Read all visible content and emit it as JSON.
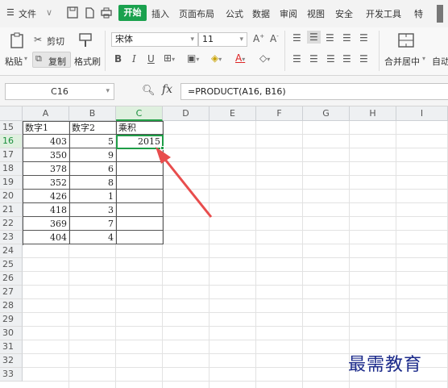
{
  "menu": {
    "items": [
      "文件",
      "开始",
      "插入",
      "页面布局",
      "公式",
      "数据",
      "审阅",
      "视图",
      "安全",
      "开发工具",
      "特"
    ],
    "active_index": 1
  },
  "ribbon": {
    "paste_label": "粘贴",
    "cut_label": "剪切",
    "copy_label": "复制",
    "format_painter_label": "格式刷",
    "font_name": "宋体",
    "font_size": "11",
    "merge_label": "合并居中",
    "autowrap_label": "自动"
  },
  "formula_bar": {
    "name_box": "C16",
    "fx_label": "fx",
    "formula": "=PRODUCT(A16, B16)"
  },
  "sheet": {
    "columns": [
      "A",
      "B",
      "C",
      "D",
      "E",
      "F",
      "G",
      "H",
      "I"
    ],
    "selected_column": "C",
    "rows": [
      "15",
      "16",
      "17",
      "18",
      "19",
      "20",
      "21",
      "22",
      "23",
      "24",
      "25",
      "26",
      "27",
      "28",
      "29",
      "30",
      "31",
      "32",
      "33"
    ],
    "selected_row": "16",
    "headers": [
      "数字1",
      "数字2",
      "乘积"
    ],
    "data": [
      [
        "403",
        "5",
        "2015"
      ],
      [
        "350",
        "9",
        ""
      ],
      [
        "378",
        "6",
        ""
      ],
      [
        "352",
        "8",
        ""
      ],
      [
        "426",
        "1",
        ""
      ],
      [
        "418",
        "3",
        ""
      ],
      [
        "369",
        "7",
        ""
      ],
      [
        "404",
        "4",
        ""
      ]
    ]
  },
  "annotation": {
    "arrow_color": "#e84d4d"
  },
  "watermark": "最需教育",
  "colors": {
    "accent": "#1aa14e",
    "selection": "#1f9d47"
  }
}
